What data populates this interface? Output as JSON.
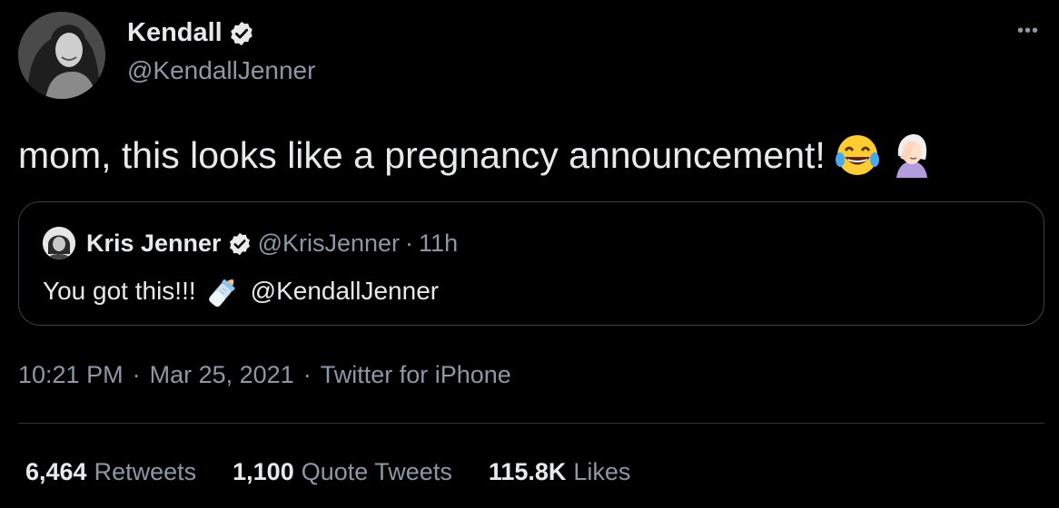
{
  "author": {
    "name": "Kendall",
    "handle": "@KendallJenner",
    "avatar_icon": "portrait-avatar",
    "verified_icon": "verified-badge-icon"
  },
  "tweet": {
    "text": "mom, this looks like a pregnancy announcement!",
    "emojis": [
      "face-with-tears-of-joy",
      "face-palm"
    ]
  },
  "quote": {
    "name": "Kris Jenner",
    "handle": "@KrisJenner",
    "separator": "·",
    "time": "11h",
    "text": "You got this!!!",
    "emoji": "baby-bottle",
    "mention": "@KendallJenner"
  },
  "meta": {
    "time": "10:21 PM",
    "sep1": "·",
    "date": "Mar 25, 2021",
    "sep2": "·",
    "source": "Twitter for iPhone"
  },
  "stats": {
    "retweets_count": "6,464",
    "retweets_label": "Retweets",
    "quotes_count": "1,100",
    "quotes_label": "Quote Tweets",
    "likes_count": "115.8K",
    "likes_label": "Likes"
  },
  "more_icon": "•••",
  "colors": {
    "background": "#000000",
    "text": "#e7e9ea",
    "secondary": "#8b98a5",
    "border": "#3a3f44"
  }
}
